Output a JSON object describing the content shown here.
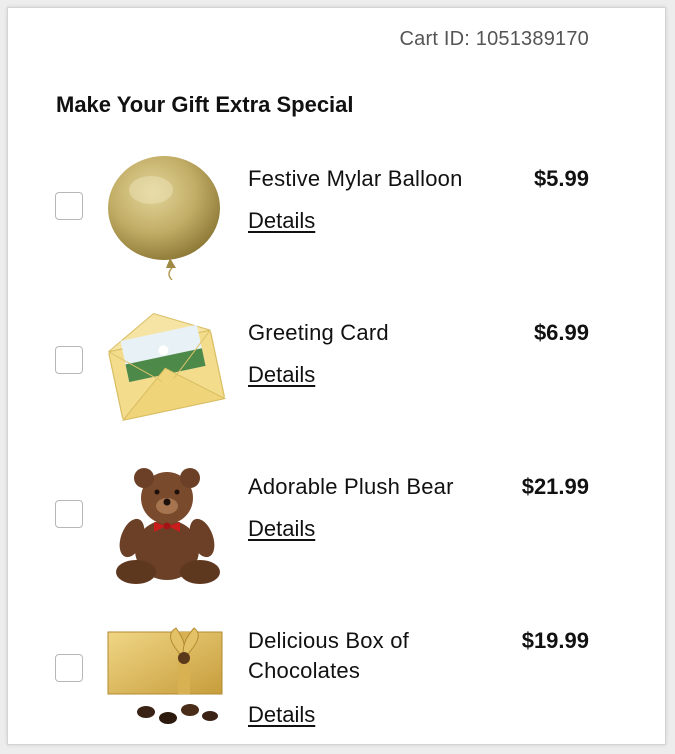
{
  "cart": {
    "id_label": "Cart ID: 1051389170"
  },
  "section": {
    "title": "Make Your Gift Extra Special"
  },
  "items": [
    {
      "name": "Festive Mylar Balloon",
      "price": "$5.99",
      "details_label": "Details",
      "checked": false,
      "icon": "balloon-image"
    },
    {
      "name": "Greeting Card",
      "price": "$6.99",
      "details_label": "Details",
      "checked": false,
      "icon": "greeting-card-image"
    },
    {
      "name": "Adorable Plush Bear",
      "price": "$21.99",
      "details_label": "Details",
      "checked": false,
      "icon": "plush-bear-image"
    },
    {
      "name": "Delicious Box of Chocolates",
      "price": "$19.99",
      "details_label": "Details",
      "checked": false,
      "icon": "chocolate-box-image"
    }
  ]
}
